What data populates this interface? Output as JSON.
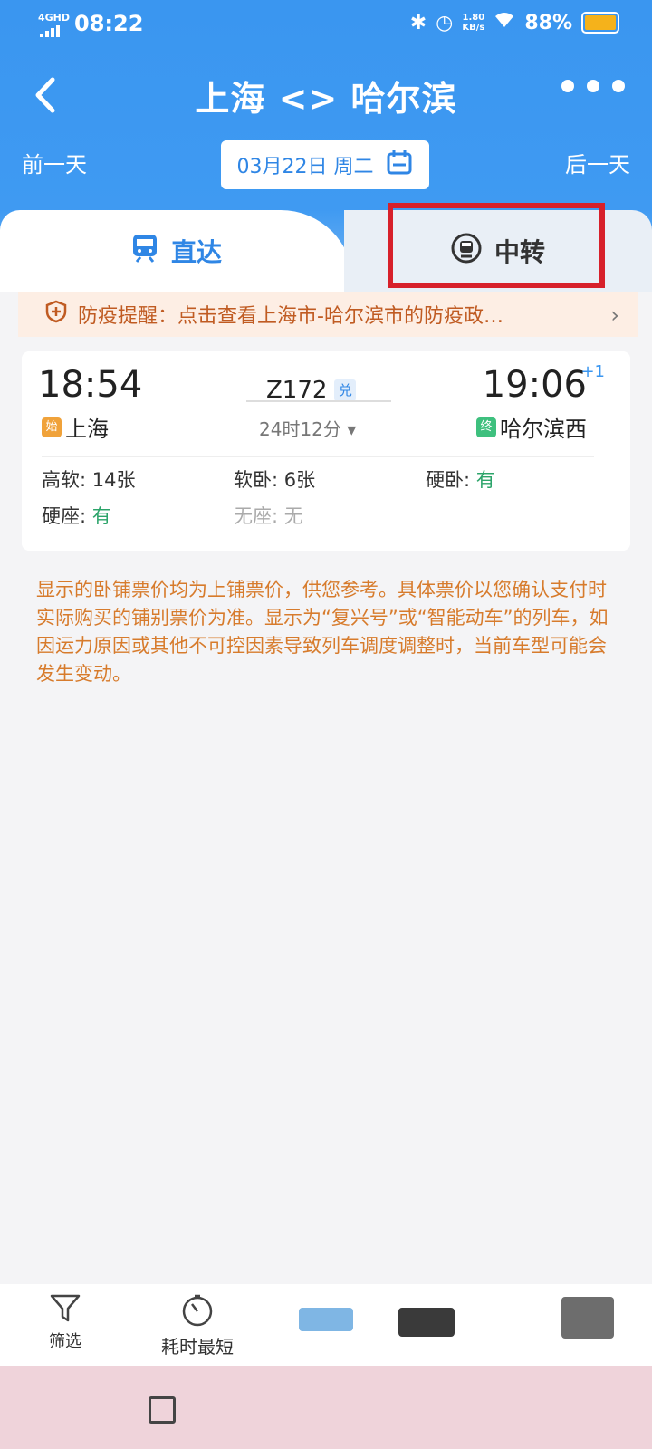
{
  "status_bar": {
    "network": "4GHD",
    "time": "08:22",
    "speed": "1.80\nKB/s",
    "battery": "88%"
  },
  "nav": {
    "title": "上海 <> 哈尔滨",
    "prev_day": "前一天",
    "next_day": "后一天",
    "date": "03月22日 周二"
  },
  "tabs": {
    "direct": "直达",
    "transfer": "中转"
  },
  "notice": {
    "text": "防疫提醒：点击查看上海市-哈尔滨市的防疫政…"
  },
  "train": {
    "dep_time": "18:54",
    "arr_time": "19:06",
    "plus_day": "+1",
    "dep_badge": "始",
    "dep_station": "上海",
    "arr_badge": "终",
    "arr_station": "哈尔滨西",
    "number": "Z172",
    "exchange": "兑",
    "duration": "24时12分 ▾",
    "seats": [
      {
        "label": "高软:",
        "value": "14张"
      },
      {
        "label": "软卧:",
        "value": "6张"
      },
      {
        "label": "硬卧:",
        "value": "有"
      },
      {
        "label": "硬座:",
        "value": "有"
      },
      {
        "label": "无座:",
        "value": "无"
      }
    ]
  },
  "disclaimer": "显示的卧铺票价均为上铺票价，供您参考。具体票价以您确认支付时实际购买的铺别票价为准。显示为“复兴号”或“智能动车”的列车，如因运力原因或其他不可控因素导致列车调度调整时，当前车型可能会发生变动。",
  "bottom": {
    "filter": "筛选",
    "fastest": "耗时最短"
  },
  "colors": {
    "primary": "#3a96f0",
    "highlight": "#d7202a",
    "warning_text": "#d77b2c",
    "available": "#2ca46a"
  }
}
